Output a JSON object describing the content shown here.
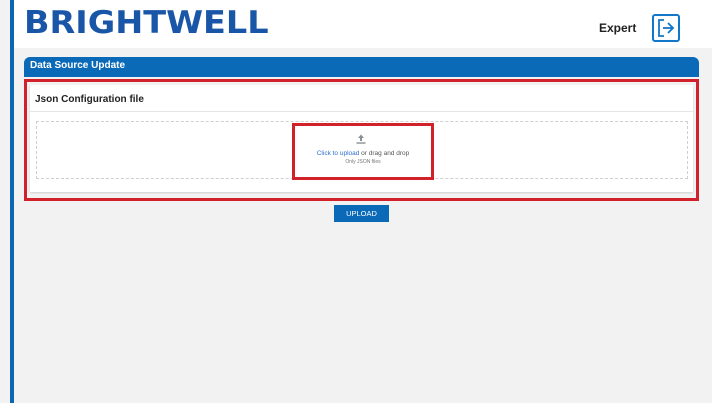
{
  "header": {
    "logo_text": "BRIGHTWELL",
    "user_role": "Expert",
    "logout_icon": "logout-icon",
    "brand_color": "#1a56a8",
    "accent_color": "#0b6ab8"
  },
  "section": {
    "title": "Data Source Update"
  },
  "card": {
    "title": "Json Configuration file"
  },
  "dropzone": {
    "icon": "upload-icon",
    "link_text": "Click to upload",
    "rest_text": " or drag and drop",
    "hint": "Only JSON files"
  },
  "actions": {
    "upload_label": "UPLOAD"
  },
  "annotations": {
    "highlight_color": "#d1222b"
  }
}
